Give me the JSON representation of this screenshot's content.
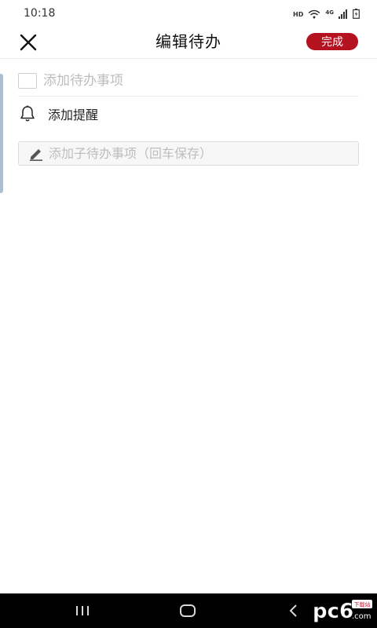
{
  "status_bar": {
    "time": "10:18",
    "hd": "HD",
    "network": "4G",
    "icons": [
      "wifi-icon",
      "signal-icon",
      "battery-icon"
    ]
  },
  "header": {
    "title": "编辑待办",
    "done_label": "完成",
    "close_icon": "close-icon"
  },
  "todo": {
    "placeholder": "添加待办事项",
    "value": ""
  },
  "reminder": {
    "icon": "bell-icon",
    "label": "添加提醒"
  },
  "subtask": {
    "icon": "pencil-icon",
    "placeholder": "添加子待办事项（回车保存）",
    "value": ""
  },
  "nav_bar": {
    "icons": [
      "recent-apps-icon",
      "home-icon",
      "back-icon"
    ]
  },
  "watermark": {
    "text": "pc6",
    "suffix": ".com",
    "badge": "下载站"
  },
  "colors": {
    "accent": "#b51220",
    "edge_tab": "#a9bfd1",
    "placeholder": "#bdbdbd"
  }
}
